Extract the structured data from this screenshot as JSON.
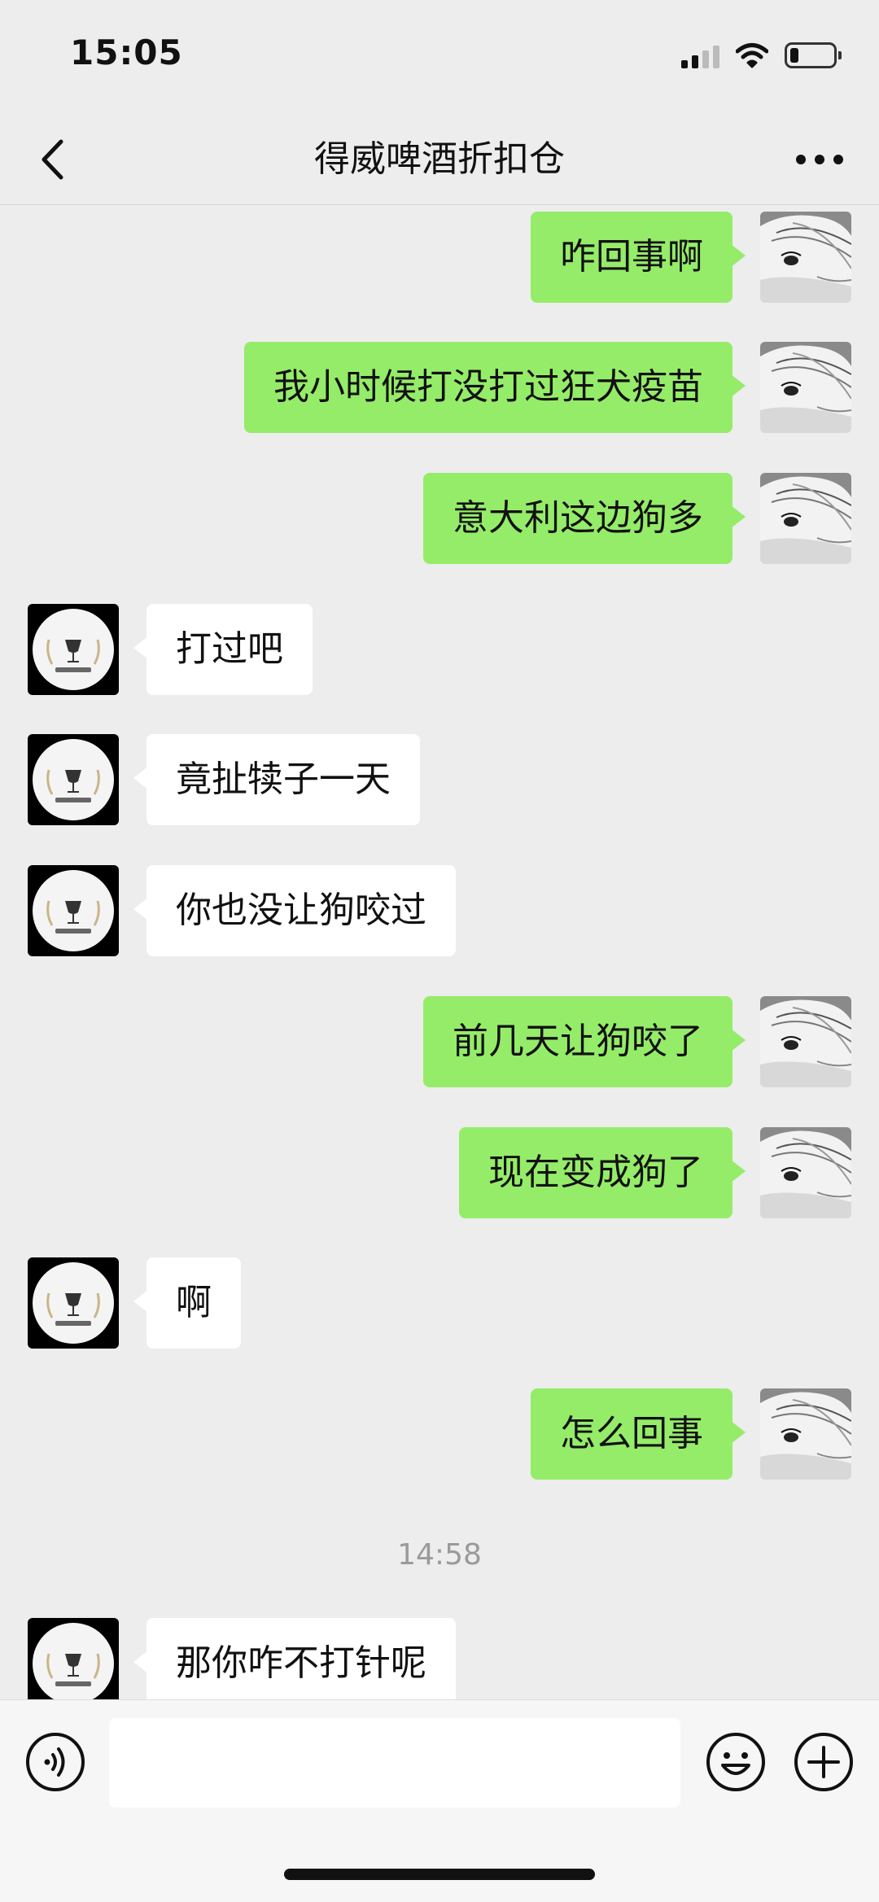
{
  "status_bar": {
    "time": "15:05",
    "signal_icon": "cellular-signal-icon",
    "wifi_icon": "wifi-icon",
    "battery_icon": "battery-low-icon"
  },
  "header": {
    "title": "得威啤酒折扣仓",
    "back_icon": "chevron-left-icon",
    "more_icon": "more-dots-icon"
  },
  "messages": [
    {
      "side": "out",
      "text": "咋回事啊"
    },
    {
      "side": "out",
      "text": "我小时候打没打过狂犬疫苗"
    },
    {
      "side": "out",
      "text": "意大利这边狗多"
    },
    {
      "side": "in",
      "text": "打过吧"
    },
    {
      "side": "in",
      "text": "竟扯犊子一天"
    },
    {
      "side": "in",
      "text": "你也没让狗咬过"
    },
    {
      "side": "out",
      "text": "前几天让狗咬了"
    },
    {
      "side": "out",
      "text": "现在变成狗了"
    },
    {
      "side": "in",
      "text": "啊"
    },
    {
      "side": "out",
      "text": "怎么回事"
    },
    {
      "side": "in",
      "text": "那你咋不打针呢"
    }
  ],
  "timestamp": "14:58",
  "input_bar": {
    "voice_icon": "voice-icon",
    "emoji_icon": "emoji-icon",
    "plus_icon": "plus-circle-icon",
    "text_value": ""
  },
  "colors": {
    "outgoing_bubble": "#95ec69",
    "incoming_bubble": "#ffffff",
    "background": "#ededed"
  }
}
